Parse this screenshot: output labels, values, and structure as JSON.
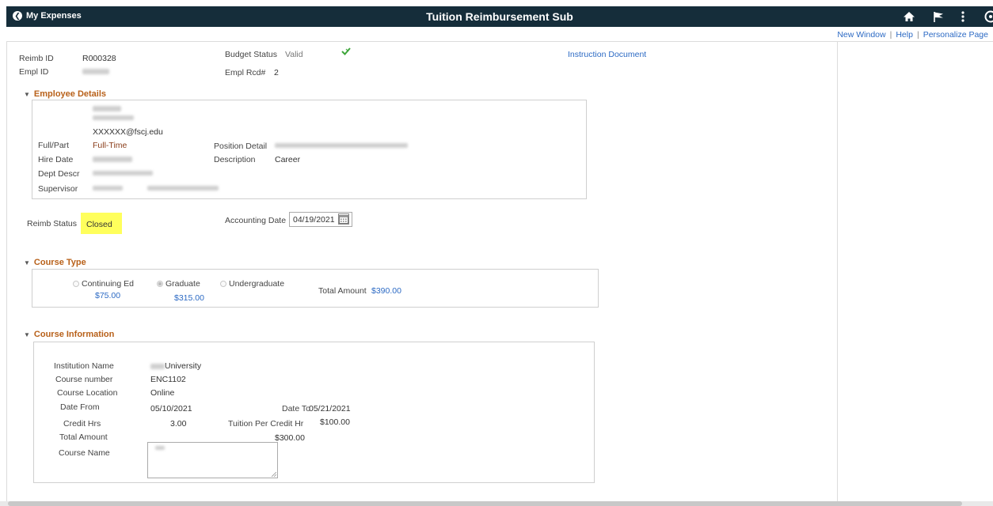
{
  "header": {
    "back_label": "My Expenses",
    "title": "Tuition Reimbursement Sub"
  },
  "top_links": [
    "New Window",
    "Help",
    "Personalize Page"
  ],
  "summary": {
    "reimb_id_label": "Reimb ID",
    "reimb_id_value": "R000328",
    "empl_id_label": "Empl ID",
    "budget_status_label": "Budget Status",
    "budget_status_value": "Valid",
    "empl_rcd_label": "Empl Rcd#",
    "empl_rcd_value": "2",
    "instruction_link": "Instruction Document"
  },
  "employee_details": {
    "section_title": "Employee Details",
    "email": "XXXXXX@fscj.edu",
    "full_part_label": "Full/Part",
    "full_part_value": "Full-Time",
    "position_detail_label": "Position Detail",
    "hire_date_label": "Hire Date",
    "description_label": "Description",
    "description_value": "Career",
    "dept_descr_label": "Dept Descr",
    "supervisor_label": "Supervisor"
  },
  "status": {
    "reimb_status_label": "Reimb Status",
    "reimb_status_value": "Closed",
    "accounting_date_label": "Accounting Date",
    "accounting_date_value": "04/19/2021"
  },
  "course_type": {
    "section_title": "Course Type",
    "options": [
      {
        "label": "Continuing Ed",
        "amount": "$75.00",
        "selected": false
      },
      {
        "label": "Graduate",
        "amount": "$315.00",
        "selected": true
      },
      {
        "label": "Undergraduate",
        "amount": "",
        "selected": false
      }
    ],
    "total_amount_label": "Total Amount",
    "total_amount_value": "$390.00"
  },
  "course_info": {
    "section_title": "Course Information",
    "institution_name_label": "Institution Name",
    "institution_name_value": "University",
    "course_number_label": "Course number",
    "course_number_value": "ENC1102",
    "course_location_label": "Course Location",
    "course_location_value": "Online",
    "date_from_label": "Date From",
    "date_from_value": "05/10/2021",
    "date_to_label": "Date To",
    "date_to_value": "05/21/2021",
    "credit_hrs_label": "Credit Hrs",
    "credit_hrs_value": "3.00",
    "tuition_per_credit_label": "Tuition Per Credit Hr",
    "tuition_per_credit_value": "$100.00",
    "total_amount_label": "Total Amount",
    "total_amount_value": "$300.00",
    "course_name_label": "Course Name"
  },
  "icons": {
    "budget_status": "budget-check-icon",
    "home": "home-icon",
    "flag": "flag-icon",
    "menu": "kebab-menu-icon",
    "navbar": "compass-icon"
  },
  "colors": {
    "header_bg": "#152d3a",
    "section_title": "#b8611a",
    "link": "#2c6ac4",
    "status_highlight": "#ffff5c"
  }
}
